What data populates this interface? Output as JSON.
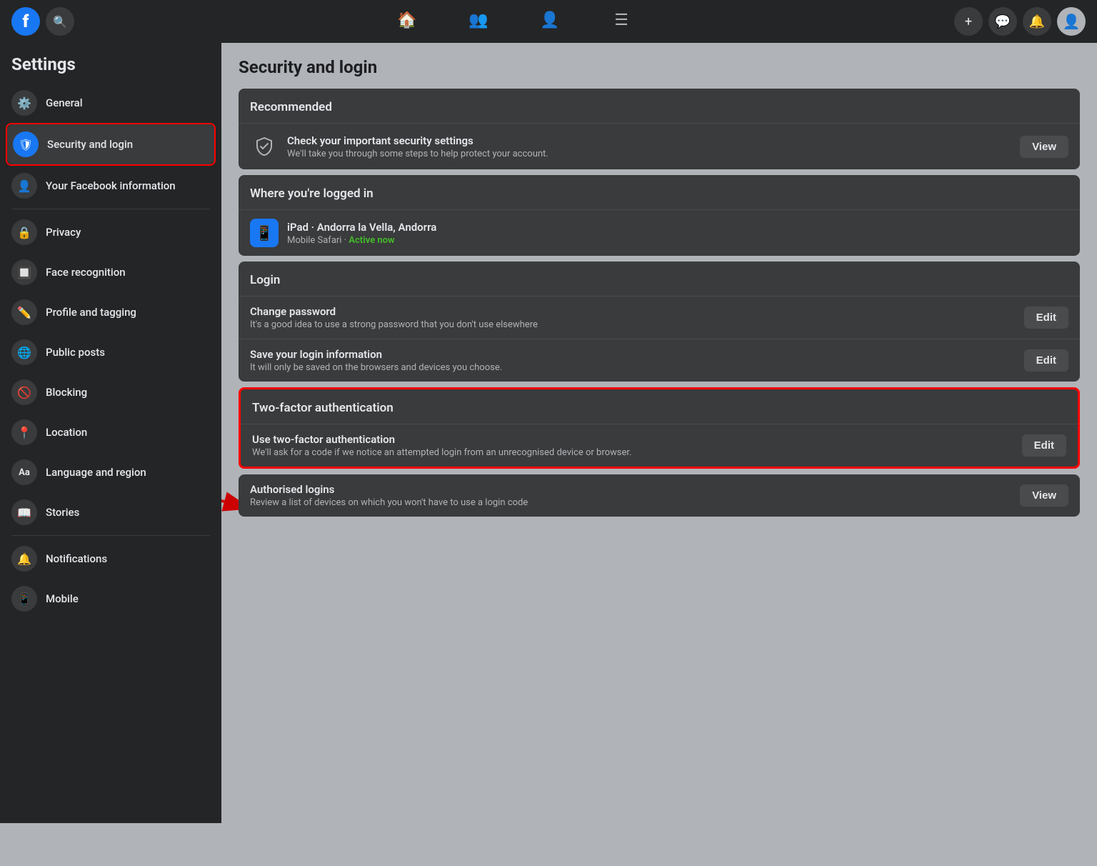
{
  "topnav": {
    "logo": "f",
    "search_icon": "🔍",
    "nav_items": [
      {
        "icon": "🏠",
        "name": "home"
      },
      {
        "icon": "👥",
        "name": "friends"
      },
      {
        "icon": "👤",
        "name": "groups"
      },
      {
        "icon": "☰",
        "name": "menu"
      }
    ],
    "action_items": [
      {
        "icon": "+",
        "name": "create"
      },
      {
        "icon": "💬",
        "name": "messenger"
      },
      {
        "icon": "🔔",
        "name": "notifications"
      }
    ]
  },
  "sidebar": {
    "title": "Settings",
    "items": [
      {
        "label": "General",
        "icon": "⚙️",
        "active": false
      },
      {
        "label": "Security and login",
        "icon": "🛡",
        "active": true
      },
      {
        "label": "Your Facebook information",
        "icon": "👤",
        "active": false
      },
      {
        "label": "Privacy",
        "icon": "🔒",
        "active": false
      },
      {
        "label": "Face recognition",
        "icon": "🔲",
        "active": false
      },
      {
        "label": "Profile and tagging",
        "icon": "✏️",
        "active": false
      },
      {
        "label": "Public posts",
        "icon": "🌐",
        "active": false
      },
      {
        "label": "Blocking",
        "icon": "🚫",
        "active": false
      },
      {
        "label": "Location",
        "icon": "📍",
        "active": false
      },
      {
        "label": "Language and region",
        "icon": "Aa",
        "active": false
      },
      {
        "label": "Stories",
        "icon": "📖",
        "active": false
      },
      {
        "label": "Notifications",
        "icon": "🔔",
        "active": false
      },
      {
        "label": "Mobile",
        "icon": "📱",
        "active": false
      }
    ]
  },
  "main": {
    "page_title": "Security and login",
    "recommended_section": {
      "header": "Recommended",
      "rows": [
        {
          "title": "Check your important security settings",
          "subtitle": "We'll take you through some steps to help protect your account.",
          "action": "View"
        }
      ]
    },
    "logged_in_section": {
      "header": "Where you're logged in",
      "rows": [
        {
          "device": "iPad · Andorra la Vella, Andorra",
          "browser": "Mobile Safari · ",
          "active_now": "Active now"
        }
      ]
    },
    "login_section": {
      "header": "Login",
      "rows": [
        {
          "title": "Change password",
          "subtitle": "It's a good idea to use a strong password that you don't use elsewhere",
          "action": "Edit"
        },
        {
          "title": "Save your login information",
          "subtitle": "It will only be saved on the browsers and devices you choose.",
          "action": "Edit"
        }
      ]
    },
    "tfa_section": {
      "header": "Two-factor authentication",
      "rows": [
        {
          "title": "Use two-factor authentication",
          "subtitle": "We'll ask for a code if we notice an attempted login from an unrecognised device or browser.",
          "action": "Edit"
        }
      ]
    },
    "authorised_section": {
      "rows": [
        {
          "title": "Authorised logins",
          "subtitle": "Review a list of devices on which you won't have to use a login code",
          "action": "View"
        }
      ]
    }
  }
}
